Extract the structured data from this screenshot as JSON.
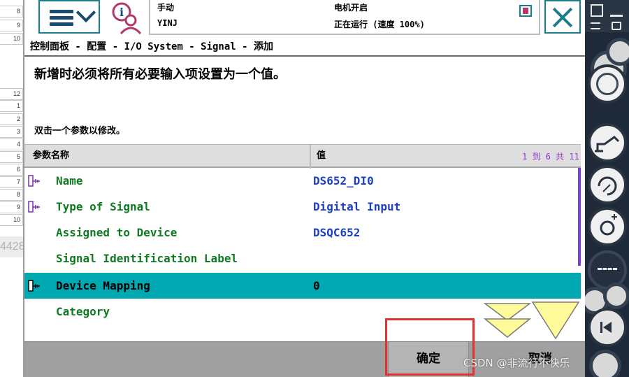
{
  "sheet": {
    "row_numbers": [
      "8",
      "9",
      "10",
      "12",
      "1",
      "2",
      "3",
      "4",
      "5",
      "6",
      "7",
      "8",
      "9",
      "10"
    ],
    "ghost_text": "4428"
  },
  "status": {
    "mode": "手动",
    "system": "YINJ",
    "motor": "电机开启",
    "run_state": "正在运行 (速度 100%)"
  },
  "breadcrumb": "控制面板 - 配置 - I/O System - Signal - 添加",
  "message": "新增时必须将所有必要输入项设置为一个值。",
  "hint": "双击一个参数以修改。",
  "table": {
    "col_param": "参数名称",
    "col_value": "值",
    "range": "1 到 6 共 11",
    "rows": [
      {
        "name": "Name",
        "value": "DS652_DI0",
        "has_icon": true,
        "selected": false
      },
      {
        "name": "Type of Signal",
        "value": "Digital Input",
        "has_icon": true,
        "selected": false
      },
      {
        "name": "Assigned to Device",
        "value": "DSQC652",
        "has_icon": false,
        "selected": false
      },
      {
        "name": "Signal Identification Label",
        "value": "",
        "has_icon": false,
        "selected": false
      },
      {
        "name": "Device Mapping",
        "value": "0",
        "has_icon": true,
        "selected": true
      },
      {
        "name": "Category",
        "value": "",
        "has_icon": false,
        "selected": false
      }
    ]
  },
  "footer": {
    "ok_label": "确定",
    "cancel_label": "取消"
  },
  "watermark": "CSDN @非流行不快乐",
  "colors": {
    "accent": "#1a7d8a",
    "selected_row": "#00a8b2",
    "param_name": "#0f7a22",
    "param_value": "#1c3fc6",
    "range_text": "#8b35c9",
    "highlight": "#e03232"
  }
}
